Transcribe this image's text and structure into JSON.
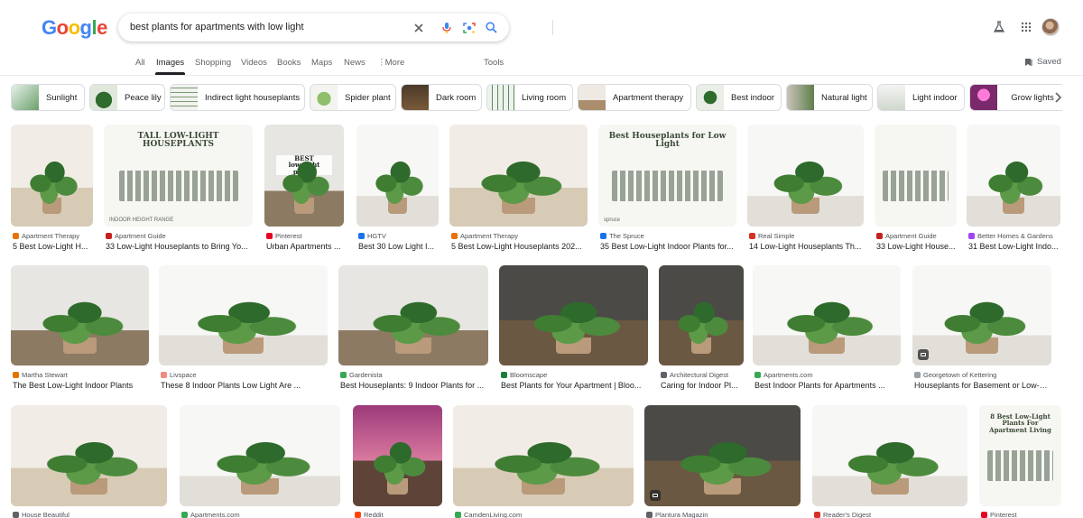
{
  "search": {
    "query": "best plants for apartments with low light"
  },
  "logo": {
    "letters": [
      "G",
      "o",
      "o",
      "g",
      "l",
      "e"
    ],
    "colors": [
      "#4285f4",
      "#ea4335",
      "#fbbc05",
      "#4285f4",
      "#34a853",
      "#ea4335"
    ]
  },
  "tabs": [
    {
      "label": "All",
      "active": false
    },
    {
      "label": "Images",
      "active": true
    },
    {
      "label": "Shopping",
      "active": false
    },
    {
      "label": "Videos",
      "active": false
    },
    {
      "label": "Books",
      "active": false
    },
    {
      "label": "Maps",
      "active": false
    },
    {
      "label": "News",
      "active": false
    },
    {
      "label": "More",
      "active": false
    }
  ],
  "tools_label": "Tools",
  "saved_label": "Saved",
  "chips": [
    "Sunlight",
    "Peace lily",
    "Indirect light houseplants",
    "Spider plant",
    "Dark room",
    "Living room",
    "Apartment therapy",
    "Best indoor",
    "Natural light",
    "Light indoor",
    "Grow lights"
  ],
  "results": [
    {
      "source": "Apartment Therapy",
      "title": "5 Best Low-Light H...",
      "fav": "#e8710a",
      "art": "wall-light"
    },
    {
      "source": "Apartment Guide",
      "title": "33 Low-Light Houseplants to Bring Yo...",
      "fav": "#c5221f",
      "art": "poster",
      "poster_text": [
        "TALL LOW-LIGHT",
        "HOUSEPLANTS"
      ],
      "poster_footer": "INDOOR HEIGHT RANGE"
    },
    {
      "source": "Pinterest",
      "title": "Urban Apartments ...",
      "fav": "#e60023",
      "art": "wall-grey",
      "poster_text": [
        "BEST",
        "low-light",
        "plants"
      ]
    },
    {
      "source": "HGTV",
      "title": "Best 30 Low Light I...",
      "fav": "#1a73e8",
      "art": "wall-white"
    },
    {
      "source": "Apartment Therapy",
      "title": "5 Best Low-Light Houseplants 202...",
      "fav": "#e8710a",
      "art": "wall-light"
    },
    {
      "source": "The Spruce",
      "title": "35 Best Low-Light Indoor Plants for...",
      "fav": "#1a73e8",
      "art": "poster",
      "poster_text": [
        "Best Houseplants for Low Light"
      ],
      "poster_footer": "spruce"
    },
    {
      "source": "Real Simple",
      "title": "14 Low-Light Houseplants Th...",
      "fav": "#d93025",
      "art": "wall-white"
    },
    {
      "source": "Apartment Guide",
      "title": "33 Low-Light House...",
      "fav": "#c5221f",
      "art": "poster"
    },
    {
      "source": "Better Homes & Gardens",
      "title": "31 Best Low-Light Indo...",
      "fav": "#a142f4",
      "art": "wall-white"
    },
    {
      "source": "Martha Stewart",
      "title": "The Best Low-Light Indoor Plants",
      "fav": "#e37400",
      "art": "wall-grey"
    },
    {
      "source": "Livspace",
      "title": "These 8 Indoor Plants Low Light Are ...",
      "fav": "#f28b82",
      "art": "wall-white"
    },
    {
      "source": "Gardenista",
      "title": "Best Houseplants: 9 Indoor Plants for ...",
      "fav": "#34a853",
      "art": "wall-grey"
    },
    {
      "source": "Bloomscape",
      "title": "Best Plants for Your Apartment | Bloo...",
      "fav": "#188038",
      "art": "wall-dark"
    },
    {
      "source": "Architectural Digest",
      "title": "Caring for Indoor Pl...",
      "fav": "#5f6368",
      "art": "wall-dark"
    },
    {
      "source": "Apartments.com",
      "title": "Best Indoor Plants for Apartments ...",
      "fav": "#34a853",
      "art": "wall-white"
    },
    {
      "source": "Georgetown of Kettering",
      "title": "Houseplants for Basement or Low-Lig...",
      "fav": "#9aa0a6",
      "art": "wall-white"
    },
    {
      "source": "House Beautiful",
      "title": "",
      "fav": "#5f6368",
      "art": "wall-light"
    },
    {
      "source": "Apartments.com",
      "title": "",
      "fav": "#34a853",
      "art": "wall-white"
    },
    {
      "source": "Reddit",
      "title": "",
      "fav": "#ff4500",
      "art": "wall-pink"
    },
    {
      "source": "CamdenLiving.com",
      "title": "",
      "fav": "#34a853",
      "art": "wall-light"
    },
    {
      "source": "Plantura Magazin",
      "title": "",
      "fav": "#5f6368",
      "art": "wall-dark"
    },
    {
      "source": "Reader's Digest",
      "title": "",
      "fav": "#d93025",
      "art": "wall-white"
    },
    {
      "source": "Pinterest",
      "title": "",
      "fav": "#e60023",
      "art": "poster",
      "poster_text": [
        "8 Best Low-Light",
        "Plants For",
        "Apartment Living"
      ]
    }
  ]
}
